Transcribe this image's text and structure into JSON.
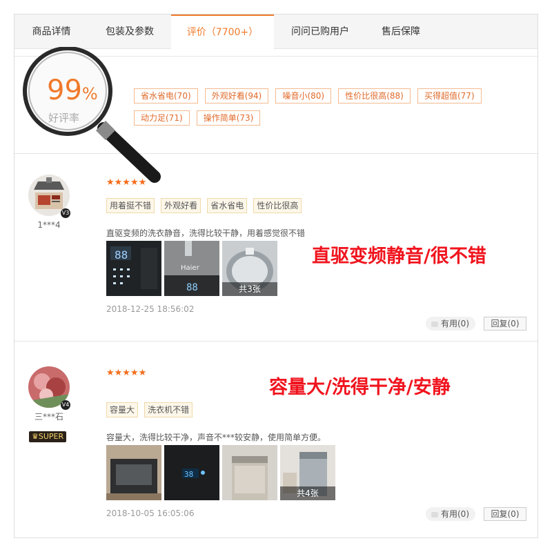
{
  "tabs": [
    "商品详情",
    "包装及参数",
    "评价（7700+）",
    "问问已购用户",
    "售后保障"
  ],
  "summary": {
    "rate_num": "99",
    "rate_pct": "%",
    "rate_label": "好评率",
    "tags": [
      "省水省电(70)",
      "外观好看(94)",
      "噪音小(80)",
      "性价比很高(88)",
      "买得超值(77)",
      "动力足(71)",
      "操作简单(73)"
    ]
  },
  "reviews": [
    {
      "user": "1***4",
      "vip": "V3",
      "stars": "★★★★★",
      "tags": [
        "用着挺不错",
        "外观好看",
        "省水省电",
        "性价比很高"
      ],
      "text": "直驱变频的洗衣静音，洗得比较干静，用着感觉很不错",
      "photo_count": "共3张",
      "date": "2018-12-25 18:56:02",
      "useful": "有用(0)",
      "reply": "回复(0)",
      "overlay": "直驱变频静音/很不错"
    },
    {
      "user": "三***石",
      "vip": "V4",
      "badge": "SUPER",
      "stars": "★★★★★",
      "tags": [
        "容量大",
        "洗衣机不错"
      ],
      "text": "容量大，洗得比较干净，声音不***较安静，使用简单方便。",
      "photo_count": "共4张",
      "date": "2018-10-05 16:05:06",
      "useful": "有用(0)",
      "reply": "回复(0)",
      "overlay": "容量大/洗得干净/安静"
    }
  ],
  "colors": {
    "accent": "#f07a2b",
    "overlay_red": "#f0141e"
  }
}
